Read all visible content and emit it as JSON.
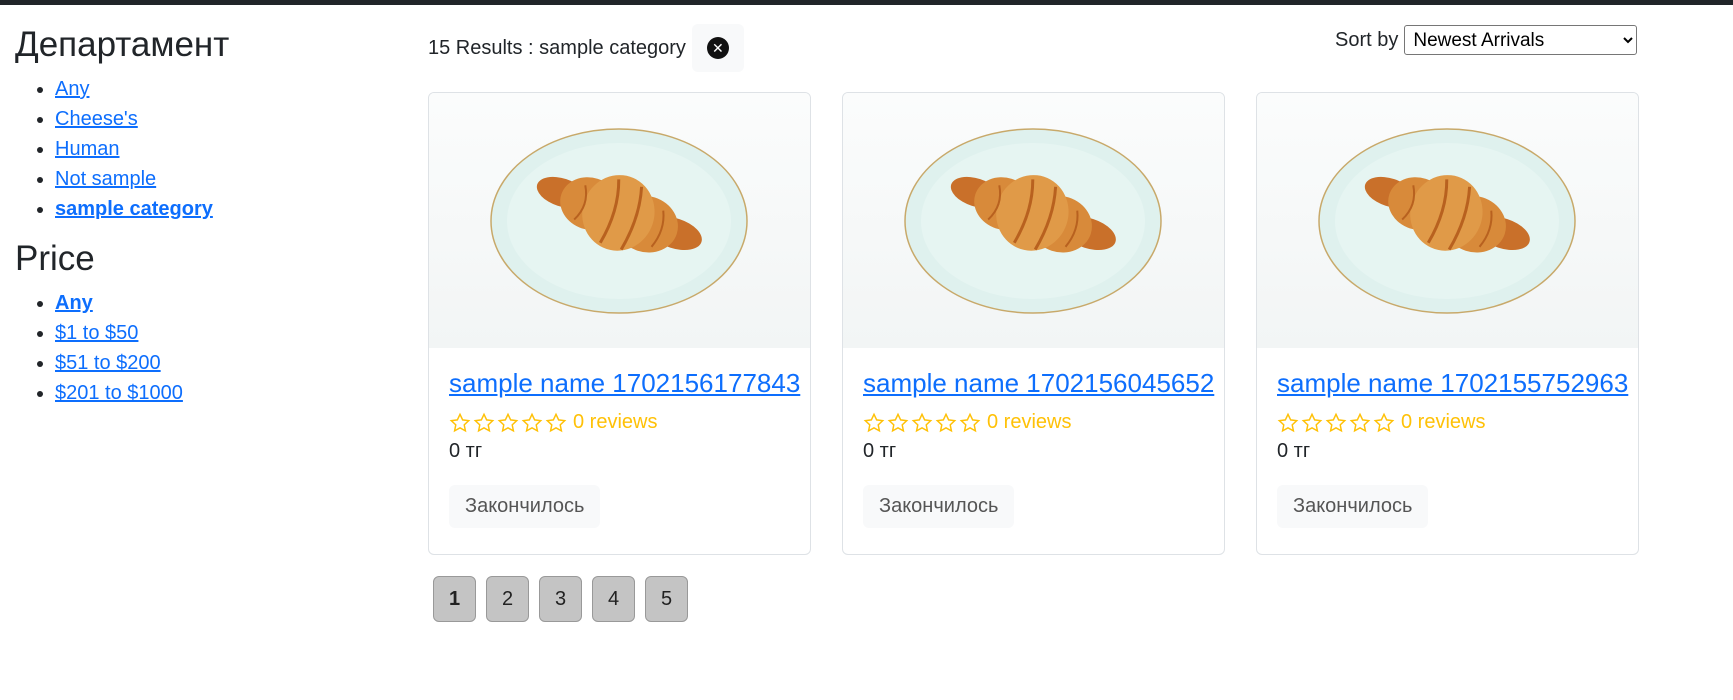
{
  "sidebar": {
    "department_title": "Департамент",
    "departments": [
      {
        "label": "Any",
        "active": false
      },
      {
        "label": "Cheese's",
        "active": false
      },
      {
        "label": "Human",
        "active": false
      },
      {
        "label": "Not sample",
        "active": false
      },
      {
        "label": "sample category",
        "active": true
      }
    ],
    "price_title": "Price",
    "prices": [
      {
        "label": "Any",
        "active": true
      },
      {
        "label": "$1 to $50",
        "active": false
      },
      {
        "label": "$51 to $200",
        "active": false
      },
      {
        "label": "$201 to $1000",
        "active": false
      }
    ]
  },
  "results": {
    "text": "15 Results : sample category",
    "clear_icon": "close-circle-icon"
  },
  "sort": {
    "label": "Sort by",
    "selected": "Newest Arrivals"
  },
  "products": [
    {
      "name": "sample name 1702156177843",
      "rating": 0,
      "reviews": "0 reviews",
      "price": "0 тг",
      "button": "Закончилось"
    },
    {
      "name": "sample name 1702156045652",
      "rating": 0,
      "reviews": "0 reviews",
      "price": "0 тг",
      "button": "Закончилось"
    },
    {
      "name": "sample name 1702155752963",
      "rating": 0,
      "reviews": "0 reviews",
      "price": "0 тг",
      "button": "Закончилось"
    }
  ],
  "pagination": {
    "pages": [
      "1",
      "2",
      "3",
      "4",
      "5"
    ],
    "current": "1"
  },
  "colors": {
    "link": "#0d6efd",
    "star": "#ffc107",
    "topbar": "#212529"
  }
}
